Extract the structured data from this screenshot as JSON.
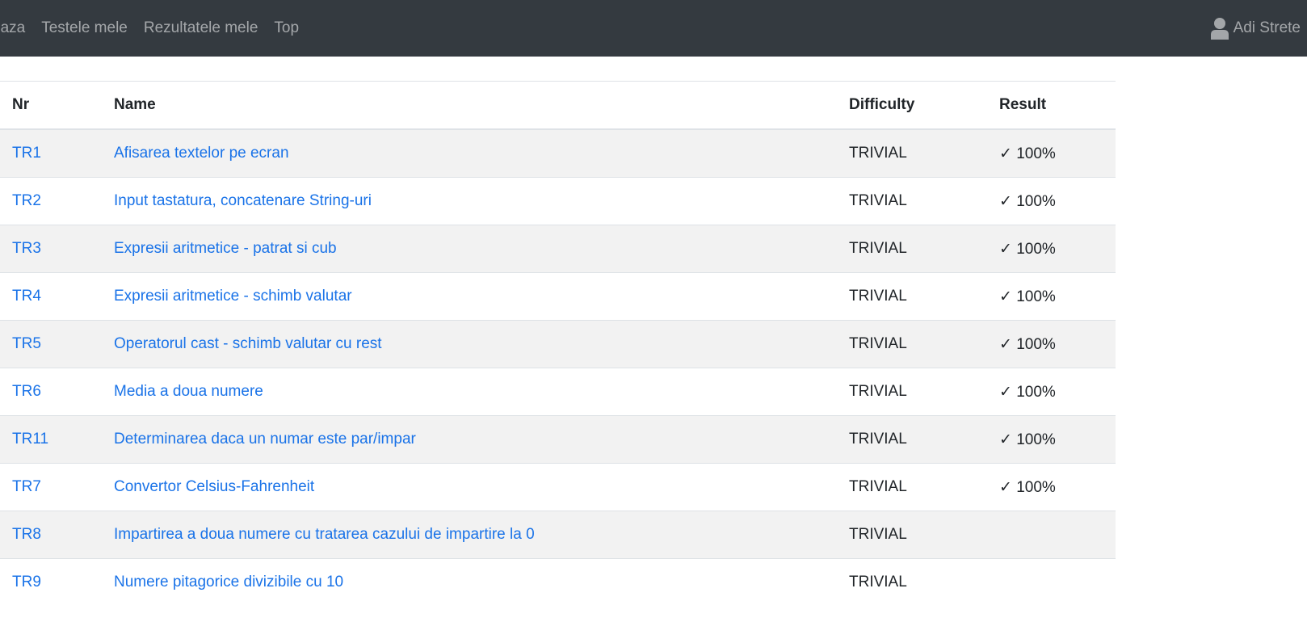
{
  "nav": {
    "links": [
      "baza",
      "Testele mele",
      "Rezultatele mele",
      "Top"
    ],
    "user_name": "Adi Strete"
  },
  "table": {
    "headers": {
      "nr": "Nr",
      "name": "Name",
      "difficulty": "Difficulty",
      "result": "Result"
    },
    "rows": [
      {
        "nr": "TR1",
        "name": "Afisarea textelor pe ecran",
        "difficulty": "TRIVIAL",
        "result": "✓ 100%"
      },
      {
        "nr": "TR2",
        "name": "Input tastatura, concatenare String-uri",
        "difficulty": "TRIVIAL",
        "result": "✓ 100%"
      },
      {
        "nr": "TR3",
        "name": "Expresii aritmetice - patrat si cub",
        "difficulty": "TRIVIAL",
        "result": "✓ 100%"
      },
      {
        "nr": "TR4",
        "name": "Expresii aritmetice - schimb valutar",
        "difficulty": "TRIVIAL",
        "result": "✓ 100%"
      },
      {
        "nr": "TR5",
        "name": "Operatorul cast - schimb valutar cu rest",
        "difficulty": "TRIVIAL",
        "result": "✓ 100%"
      },
      {
        "nr": "TR6",
        "name": "Media a doua numere",
        "difficulty": "TRIVIAL",
        "result": "✓ 100%"
      },
      {
        "nr": "TR11",
        "name": "Determinarea daca un numar este par/impar",
        "difficulty": "TRIVIAL",
        "result": "✓ 100%"
      },
      {
        "nr": "TR7",
        "name": "Convertor Celsius-Fahrenheit",
        "difficulty": "TRIVIAL",
        "result": "✓ 100%"
      },
      {
        "nr": "TR8",
        "name": "Impartirea a doua numere cu tratarea cazului de impartire la 0",
        "difficulty": "TRIVIAL",
        "result": ""
      },
      {
        "nr": "TR9",
        "name": "Numere pitagorice divizibile cu 10",
        "difficulty": "TRIVIAL",
        "result": ""
      }
    ]
  },
  "colors": {
    "navbar_bg": "#343a40",
    "link": "#1a73e8",
    "striped_row": "#f2f2f2"
  },
  "icons": {
    "user": "user-icon"
  }
}
